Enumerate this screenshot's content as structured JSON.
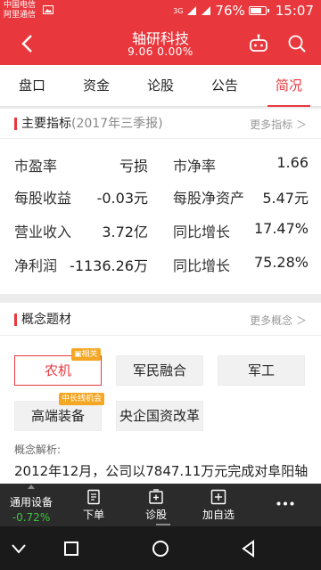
{
  "status_bar": {
    "carrier_line1": "中国电信",
    "carrier_line2": "阿里通信",
    "network": "3G",
    "battery": "76%",
    "time": "15:07"
  },
  "header": {
    "title": "轴研科技",
    "subtitle": "9.06  0.00%",
    "icons": [
      "back-arrow-icon",
      "robot-icon",
      "search-icon"
    ]
  },
  "tabs": [
    {
      "label": "盘口",
      "active": false
    },
    {
      "label": "资金",
      "active": false
    },
    {
      "label": "论股",
      "active": false
    },
    {
      "label": "公告",
      "active": false
    },
    {
      "label": "简况",
      "active": true
    }
  ],
  "indicators": {
    "title": "主要指标",
    "subtitle": "(2017年三季报)",
    "more": "更多指标 ＞",
    "rows": [
      {
        "label1": "市盈率",
        "value1": "亏损",
        "label2": "市净率",
        "value2": "1.66"
      },
      {
        "label1": "每股收益",
        "value1": "-0.03元",
        "label2": "每股净资产",
        "value2": "5.47元"
      },
      {
        "label1": "营业收入",
        "value1": "3.72亿",
        "label2": "同比增长",
        "value2": "17.47%"
      },
      {
        "label1": "净利润",
        "value1": "-1136.26万",
        "label2": "同比增长",
        "value2": "75.28%"
      }
    ]
  },
  "concepts": {
    "title": "概念题材",
    "more": "更多概念 ＞",
    "chips": [
      {
        "label": "农机",
        "tag": "相关"
      },
      {
        "label": "军民融合",
        "tag": ""
      },
      {
        "label": "军工",
        "tag": ""
      },
      {
        "label": "高端装备",
        "tag": "中长线机会"
      },
      {
        "label": "央企国资改革",
        "tag": ""
      }
    ],
    "analysis_label": "概念解析:",
    "analysis_text": "2012年12月，公司以7847.11万元完成对阜阳轴"
  },
  "toolbar": {
    "stock_name": "通用设备",
    "stock_change": "-0.72%",
    "items": [
      {
        "label": "下单",
        "icon": "order-icon"
      },
      {
        "label": "诊股",
        "icon": "diagnose-icon"
      },
      {
        "label": "加自选",
        "icon": "add-watchlist-icon"
      }
    ],
    "more_icon": "more-dots-icon"
  },
  "colors": {
    "brand": "#e8383d",
    "positive": "#e8383d",
    "negative": "#3cc43c",
    "tag": "#f5a623"
  }
}
